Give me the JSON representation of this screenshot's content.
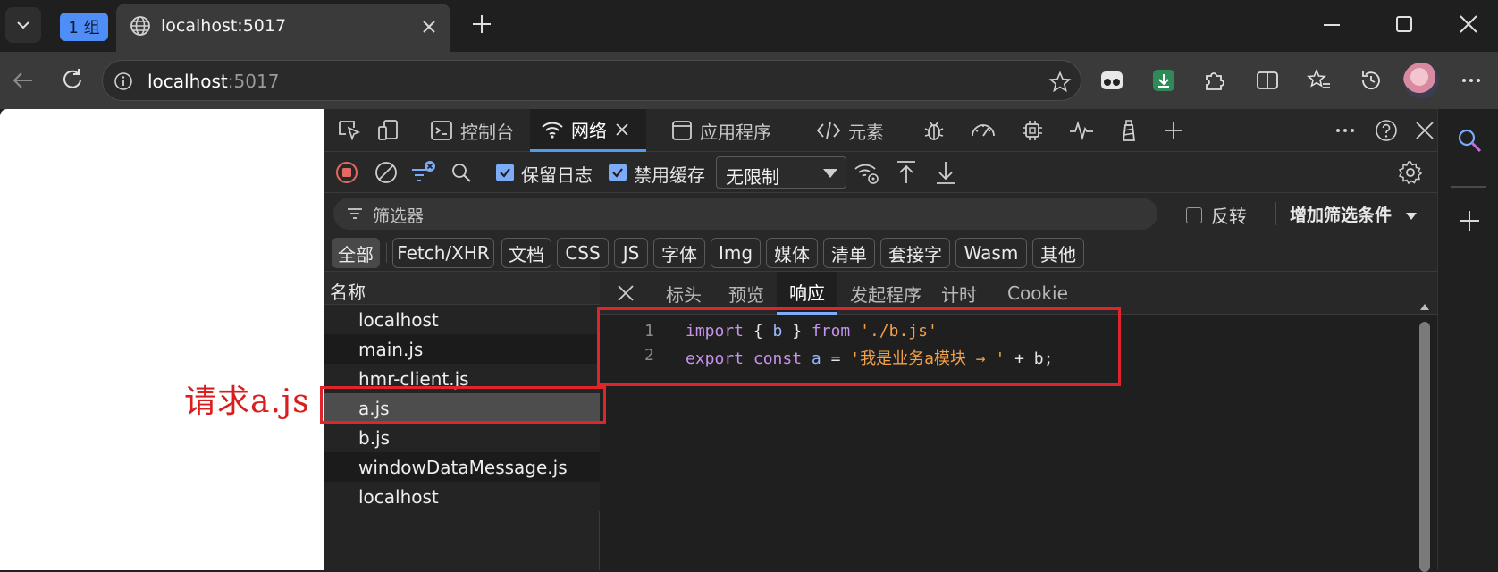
{
  "titlebar": {
    "tab_group_label": "1 组",
    "active_tab_title": "localhost:5017"
  },
  "address": {
    "host": "localhost",
    "port": ":5017"
  },
  "devtools": {
    "tabs": {
      "console": "控制台",
      "network": "网络",
      "application": "应用程序",
      "elements": "元素"
    },
    "toolbar": {
      "preserve_log": "保留日志",
      "disable_cache": "禁用缓存",
      "throttle_value": "无限制"
    },
    "filter": {
      "placeholder": "筛选器",
      "invert": "反转",
      "more_filters": "增加筛选条件"
    },
    "type_filters": [
      "全部",
      "Fetch/XHR",
      "文档",
      "CSS",
      "JS",
      "字体",
      "Img",
      "媒体",
      "清单",
      "套接字",
      "Wasm",
      "其他"
    ],
    "request_list": {
      "header": "名称",
      "rows": [
        "localhost",
        "main.js",
        "hmr-client.js",
        "a.js",
        "b.js",
        "windowDataMessage.js",
        "localhost"
      ],
      "selected_index": 3
    },
    "detail_tabs": [
      "标头",
      "预览",
      "响应",
      "发起程序",
      "计时",
      "Cookie"
    ],
    "active_detail_tab": "响应",
    "response_code": {
      "line_numbers": [
        "1",
        "2"
      ],
      "line1": {
        "kw1": "import",
        "p1": " { ",
        "id1": "b",
        "p2": " } ",
        "kw2": "from",
        "p3": " ",
        "str": "'./b.js'"
      },
      "line2": {
        "kw1": "export",
        "p1": " ",
        "kw2": "const",
        "p2": " ",
        "id1": "a",
        "p3": " = ",
        "str": "'我是业务a模块 → '",
        "p4": " + b;"
      }
    }
  },
  "annotation": {
    "label": "请求a.js",
    "color": "#d81e1e"
  },
  "colors": {
    "accent_blue": "#4d9ee8",
    "checkbox_blue": "#7cacf8",
    "record_red": "#e46962"
  }
}
